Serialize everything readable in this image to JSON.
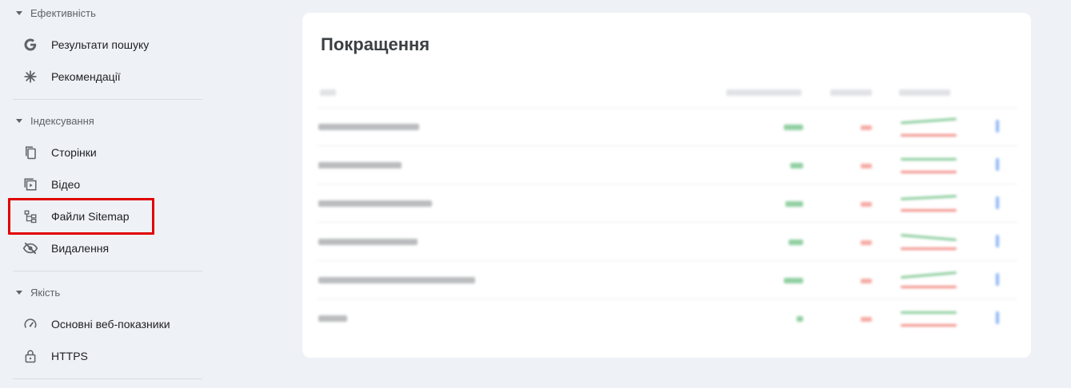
{
  "sidebar": {
    "sections": [
      {
        "title": "Ефективність",
        "items": [
          {
            "label": "Результати пошуку",
            "icon": "google-g-icon"
          },
          {
            "label": "Рекомендації",
            "icon": "asterisk-icon"
          }
        ]
      },
      {
        "title": "Індексування",
        "items": [
          {
            "label": "Сторінки",
            "icon": "pages-icon"
          },
          {
            "label": "Відео",
            "icon": "video-icon"
          },
          {
            "label": "Файли Sitemap",
            "icon": "sitemap-icon",
            "highlighted": true
          },
          {
            "label": "Видалення",
            "icon": "eye-off-icon"
          }
        ]
      },
      {
        "title": "Якість",
        "items": [
          {
            "label": "Основні веб-показники",
            "icon": "speedometer-icon"
          },
          {
            "label": "HTTPS",
            "icon": "lock-icon"
          }
        ]
      }
    ],
    "highlight_color": "#e00000"
  },
  "main": {
    "card": {
      "title": "Покращення"
    }
  }
}
